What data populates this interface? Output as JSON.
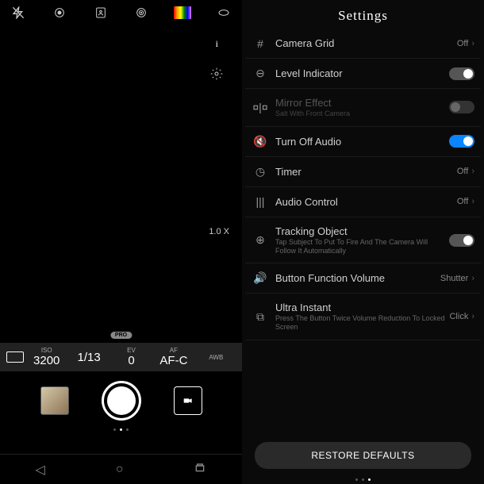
{
  "camera": {
    "info": "i",
    "zoom": "1.0 X",
    "pro_badge": "PRO",
    "pro": {
      "iso_label": "ISO",
      "iso": "3200",
      "shutter": "1/13",
      "ev_label": "EV",
      "ev": "0",
      "af_label": "AF",
      "af": "AF-C",
      "awb": "AWB"
    }
  },
  "settings": {
    "title": "Settings",
    "items": [
      {
        "title": "Camera Grid",
        "value": "Off",
        "type": "link"
      },
      {
        "title": "Level Indicator",
        "type": "toggle",
        "on": true
      },
      {
        "title": "Mirror Effect",
        "sub": "Salt With Front Camera",
        "type": "toggle",
        "on": false,
        "dimmed": true
      },
      {
        "title": "Turn Off Audio",
        "type": "toggle",
        "on": true,
        "blue": true
      },
      {
        "title": "Timer",
        "value": "Off",
        "type": "link"
      },
      {
        "title": "Audio Control",
        "value": "Off",
        "type": "link"
      },
      {
        "title": "Tracking Object",
        "sub": "Tap Subject To Put To Fire And The Camera Will Follow It Automatically",
        "type": "toggle",
        "on": true
      },
      {
        "title": "Button Function Volume",
        "value": "Shutter",
        "type": "link"
      },
      {
        "title": "Ultra Instant",
        "sub": "Press The Button Twice Volume Reduction To Locked Screen",
        "value": "Click",
        "type": "link"
      }
    ],
    "restore": "RESTORE DEFAULTS"
  }
}
